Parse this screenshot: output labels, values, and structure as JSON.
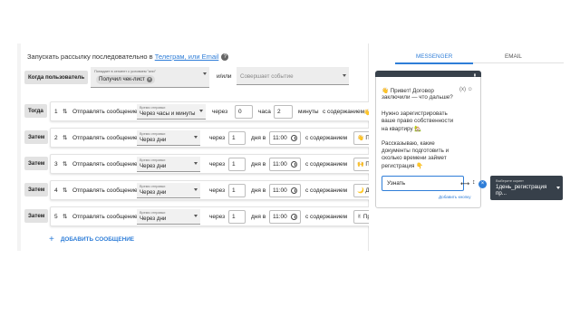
{
  "header": {
    "title_prefix": "Запускать рассылку последовательно в ",
    "title_link": "Телеграм, или Email"
  },
  "trigger": {
    "label": "Когда пользователь",
    "condition_label": "Попадает в сегмент с условием \"или\"",
    "chip": "Получил чек-лист",
    "andor": "и/или",
    "event_placeholder": "Совершает событие"
  },
  "rows": [
    {
      "tag": "Тогда",
      "num": "1",
      "action": "Отправлять сообщение",
      "time_label": "Время отправки",
      "time": "Через часы и минуты",
      "through": "через",
      "n1": "0",
      "unit1": "часа",
      "n2": "2",
      "unit2": "минуты",
      "content_label": "с содержанием",
      "content": "👋 При"
    },
    {
      "tag": "Затем",
      "num": "2",
      "action": "Отправлять сообщение",
      "time_label": "Время отправки",
      "time": "Через дни",
      "through": "через",
      "n1": "1",
      "unit1": "дня в",
      "clock": "11:00",
      "content_label": "с содержанием",
      "content": "👋 При"
    },
    {
      "tag": "Затем",
      "num": "3",
      "action": "Отправлять сообщение",
      "time_label": "Время отправки",
      "time": "Через дни",
      "through": "через",
      "n1": "1",
      "unit1": "дня в",
      "clock": "11:00",
      "content_label": "с содержанием",
      "content": "🙌 При"
    },
    {
      "tag": "Затем",
      "num": "4",
      "action": "Отправлять сообщение",
      "time_label": "Время отправки",
      "time": "Через дни",
      "through": "через",
      "n1": "1",
      "unit1": "дня в",
      "clock": "11:00",
      "content_label": "с содержанием",
      "content": "🌙 Доб"
    },
    {
      "tag": "Затем",
      "num": "5",
      "action": "Отправлять сообщение",
      "time_label": "Время отправки",
      "time": "Через дни",
      "through": "через",
      "n1": "1",
      "unit1": "дня в",
      "clock": "11:00",
      "content_label": "с содержанием",
      "content": "✌ При"
    }
  ],
  "add_message": "ДОБАВИТЬ СООБЩЕНИЕ",
  "tabs": {
    "messenger": "MESSENGER",
    "email": "EMAIL"
  },
  "preview": {
    "line1": "👋 Привет! Договор",
    "line2": "заключили — что дальше?",
    "controls": "(x) ☺",
    "p2_l1": "Нужно зарегистрировать",
    "p2_l2": "ваше право собственности",
    "p2_l3": "на квартиру 🏡",
    "p3_l1": "Рассказываю, какие",
    "p3_l2": "документы подготовить и",
    "p3_l3": "сколько времени займет",
    "p3_l4": "регистрация 👇",
    "button_value": "Узнать",
    "add_button": "Добавить кнопку"
  },
  "script": {
    "label": "Выберите скрипт",
    "value_l1": "1день_регистрация",
    "value_l2": "пр..."
  }
}
